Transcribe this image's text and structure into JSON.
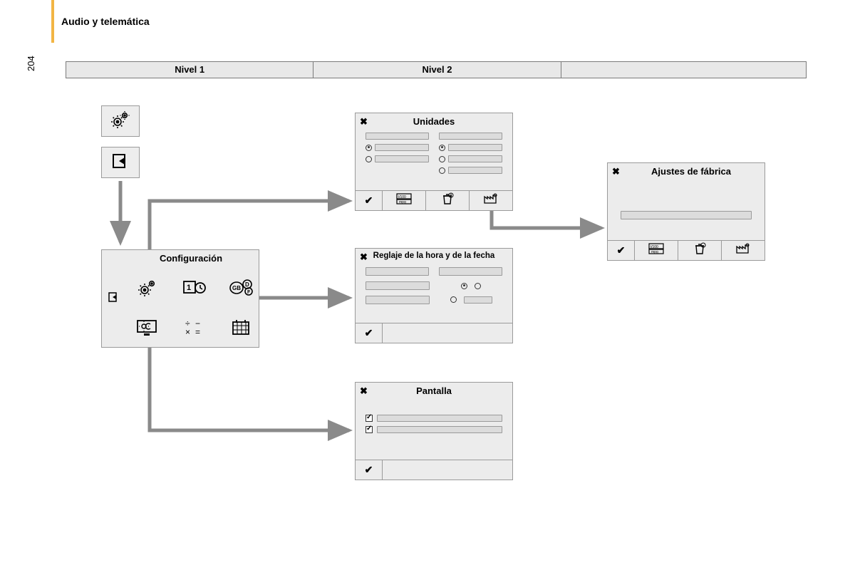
{
  "section_title": "Audio y telemática",
  "page_number": "204",
  "levels": {
    "l1": "Nivel 1",
    "l2": "Nivel 2",
    "l3": ""
  },
  "config_panel": {
    "title": "Configuración"
  },
  "unidades_panel": {
    "title": "Unidades"
  },
  "reglaje_panel": {
    "title": "Reglaje de la hora y de la fecha"
  },
  "pantalla_panel": {
    "title": "Pantalla"
  },
  "ajustes_panel": {
    "title": "Ajustes de fábrica"
  },
  "icons": {
    "gears": "gears-icon",
    "exit": "exit-icon",
    "clock": "clock-date-icon",
    "lang": "language-icon",
    "screen": "screen-brightness-icon",
    "units": "units-math-icon",
    "calendar": "calendar-grid-icon",
    "check": "✔",
    "close": "✖",
    "mpg": "mpg-units-icon",
    "reset": "trash-reset-icon",
    "factory": "factory-icon"
  }
}
